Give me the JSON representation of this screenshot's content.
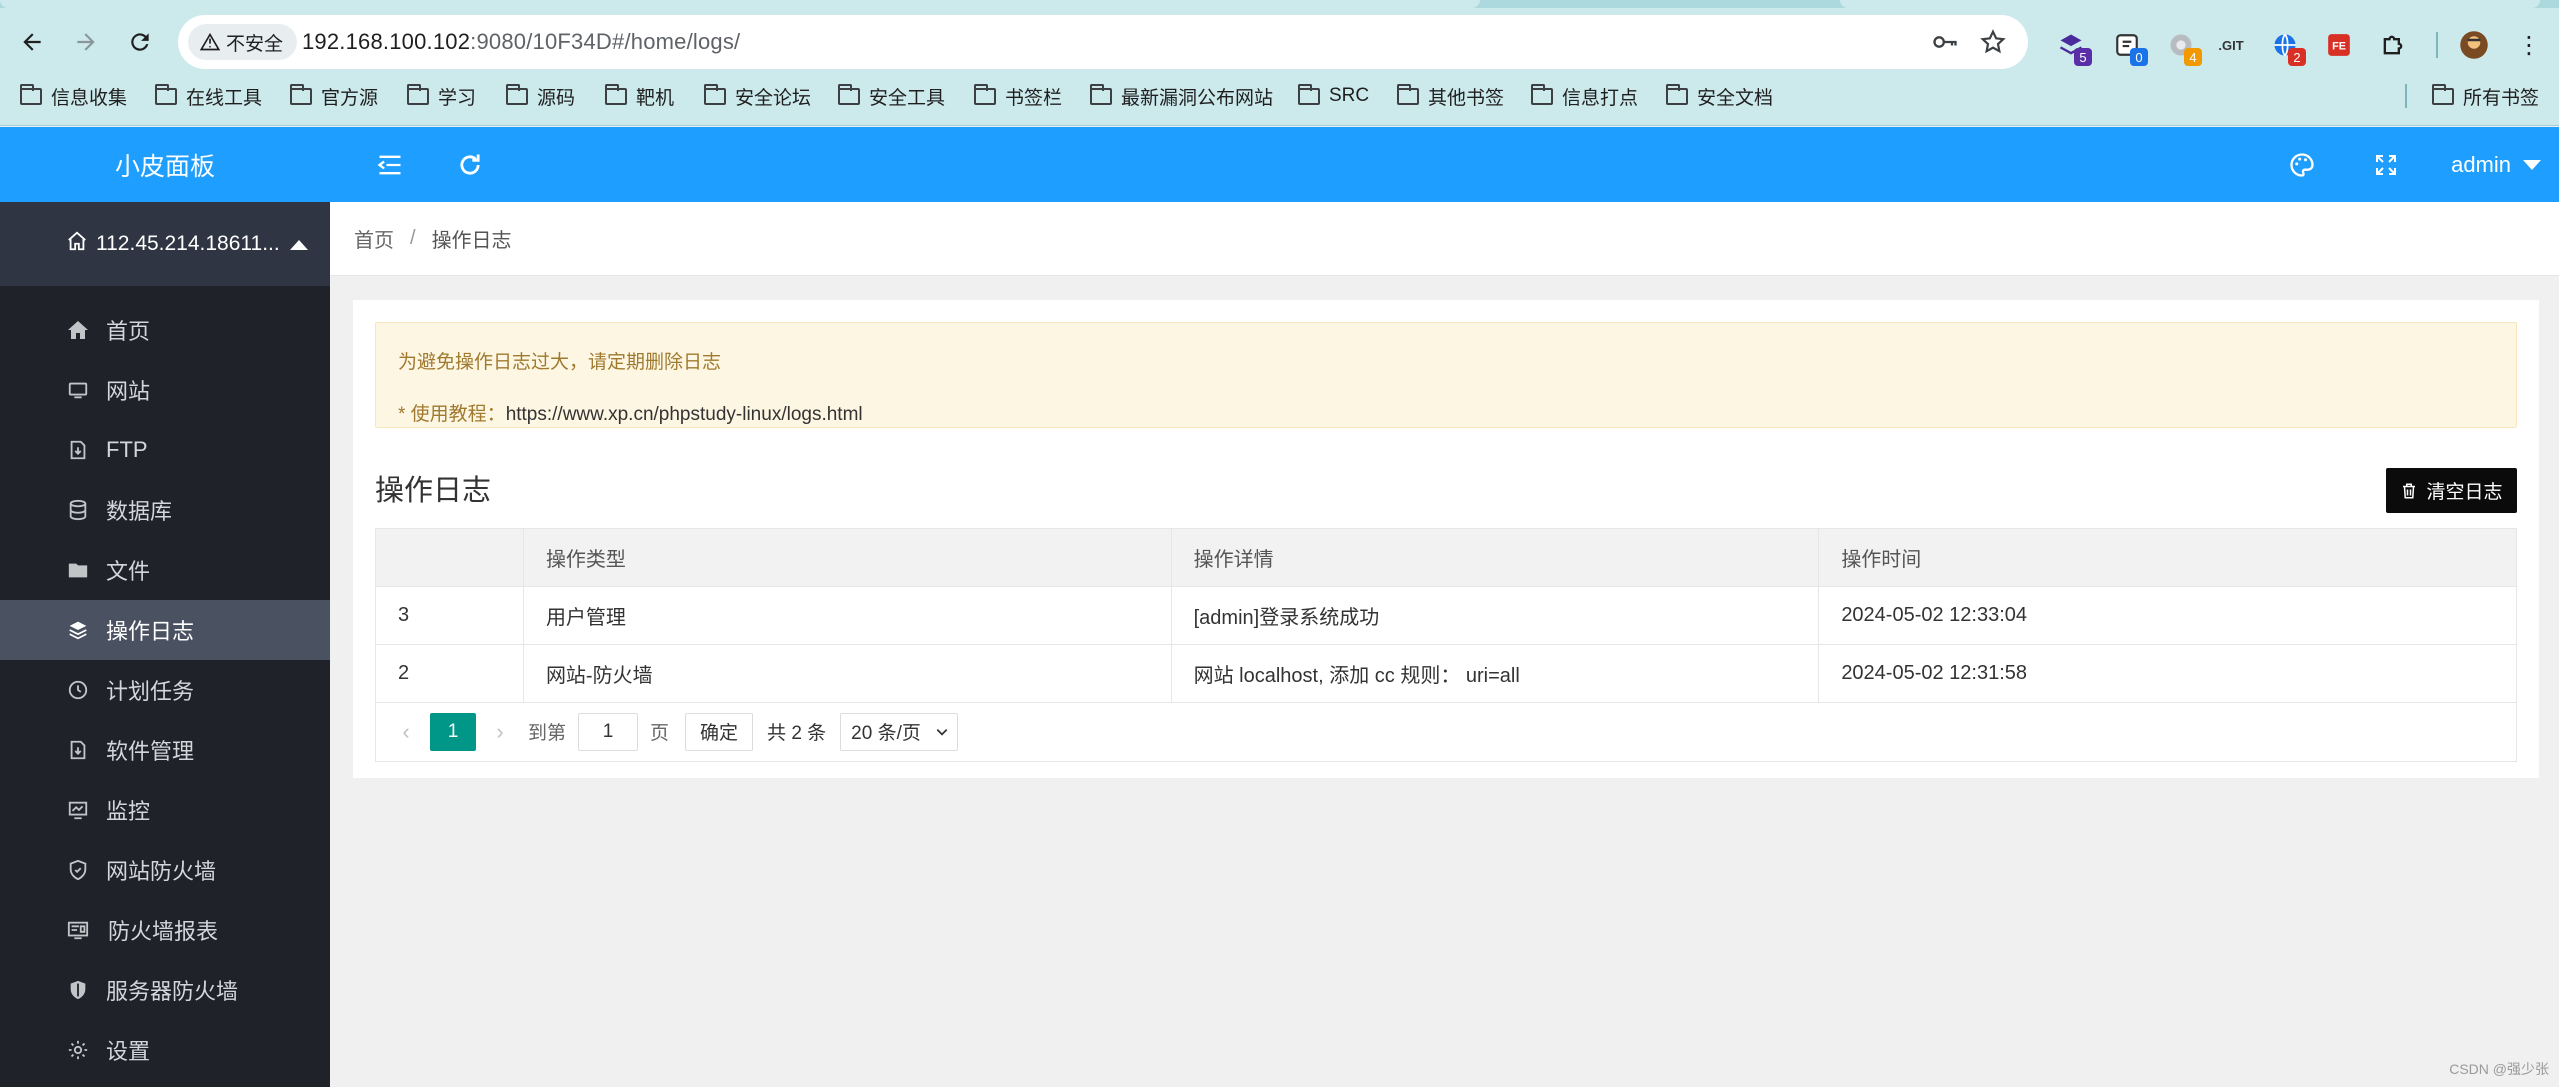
{
  "browser": {
    "url_insecure_label": "不安全",
    "url_host": "192.168.100.102",
    "url_rest": ":9080/10F34D#/home/logs/",
    "extensions": [
      {
        "name": "ext-wappalyzer",
        "badge": "5",
        "color": "#5a2ea6"
      },
      {
        "name": "ext-counter",
        "badge": "0",
        "color": "#1a73e8"
      },
      {
        "name": "ext-proxy",
        "badge": "4",
        "color": "#f29900"
      },
      {
        "name": "ext-git",
        "badge": "",
        "color": "#444444"
      },
      {
        "name": "ext-globe",
        "badge": "2",
        "color": "#d93025"
      },
      {
        "name": "ext-fe",
        "badge": "",
        "color": "#d93025"
      }
    ],
    "bookmarks": [
      "信息收集",
      "在线工具",
      "官方源",
      "学习",
      "源码",
      "靶机",
      "安全论坛",
      "安全工具",
      "书签栏",
      "最新漏洞公布网站",
      "SRC",
      "其他书签",
      "信息打点",
      "安全文档"
    ],
    "all_bookmarks": "所有书签"
  },
  "app": {
    "brand": "小皮面板",
    "user": "admin",
    "host": "112.45.214.18611...",
    "menu": [
      {
        "label": "首页",
        "icon": "home-icon"
      },
      {
        "label": "网站",
        "icon": "monitor-icon"
      },
      {
        "label": "FTP",
        "icon": "ftp-icon"
      },
      {
        "label": "数据库",
        "icon": "database-icon"
      },
      {
        "label": "文件",
        "icon": "folder-icon"
      },
      {
        "label": "操作日志",
        "icon": "layers-icon",
        "active": true
      },
      {
        "label": "计划任务",
        "icon": "clock-icon"
      },
      {
        "label": "软件管理",
        "icon": "package-icon"
      },
      {
        "label": "监控",
        "icon": "chart-monitor-icon"
      },
      {
        "label": "网站防火墙",
        "icon": "shield-icon"
      },
      {
        "label": "防火墙报表",
        "icon": "report-icon"
      },
      {
        "label": "服务器防火墙",
        "icon": "server-shield-icon"
      },
      {
        "label": "设置",
        "icon": "gear-icon"
      }
    ]
  },
  "breadcrumb": {
    "home": "首页",
    "sep": "/",
    "current": "操作日志"
  },
  "notice": {
    "line1": "为避免操作日志过大，请定期删除日志",
    "line2_prefix": "* 使用教程：",
    "line2_link": "https://www.xp.cn/phpstudy-linux/logs.html"
  },
  "section": {
    "title": "操作日志",
    "clear_button": "清空日志"
  },
  "table": {
    "headers": [
      "",
      "操作类型",
      "操作详情",
      "操作时间"
    ],
    "rows": [
      {
        "id": "3",
        "type": "用户管理",
        "detail": "[admin]登录系统成功",
        "time": "2024-05-02 12:33:04"
      },
      {
        "id": "2",
        "type": "网站-防火墙",
        "detail": "网站 localhost, 添加 cc 规则： uri=all",
        "time": "2024-05-02 12:31:58"
      }
    ]
  },
  "pager": {
    "current_page": "1",
    "goto_label": "到第",
    "goto_value": "1",
    "page_unit": "页",
    "confirm": "确定",
    "total": "共 2 条",
    "per_page": "20 条/页"
  },
  "watermark": "CSDN @强少张"
}
